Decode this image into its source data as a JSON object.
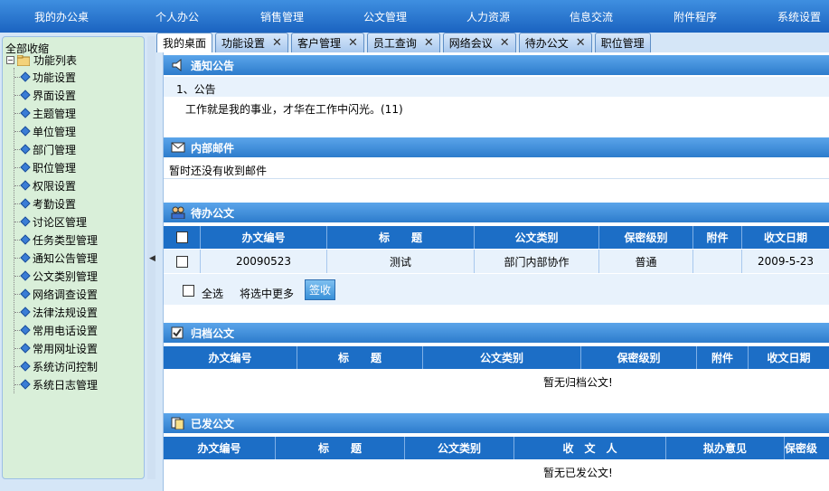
{
  "nav": {
    "home": "我的办公桌",
    "items": [
      "个人办公",
      "销售管理",
      "公文管理",
      "人力资源",
      "信息交流",
      "附件程序",
      "系统设置"
    ]
  },
  "sidebar": {
    "collapse_all": "全部收缩",
    "root_label": "功能列表",
    "items": [
      "功能设置",
      "界面设置",
      "主题管理",
      "单位管理",
      "部门管理",
      "职位管理",
      "权限设置",
      "考勤设置",
      "讨论区管理",
      "任务类型管理",
      "通知公告管理",
      "公文类别管理",
      "网络调查设置",
      "法律法规设置",
      "常用电话设置",
      "常用网址设置",
      "系统访问控制",
      "系统日志管理"
    ]
  },
  "tabs": [
    {
      "label": "我的桌面",
      "closable": false
    },
    {
      "label": "功能设置",
      "closable": true
    },
    {
      "label": "客户管理",
      "closable": true
    },
    {
      "label": "员工查询",
      "closable": true
    },
    {
      "label": "网络会议",
      "closable": true
    },
    {
      "label": "待办公文",
      "closable": true
    },
    {
      "label": "职位管理",
      "closable": false
    }
  ],
  "notice": {
    "title": "通知公告",
    "item_index": "1、公告",
    "item_text": "工作就是我的事业，才华在工作中闪光。(11)"
  },
  "mail": {
    "title": "内部邮件",
    "empty": "暂时还没有收到邮件"
  },
  "pending": {
    "title": "待办公文",
    "headers": [
      "办文编号",
      "标　　题",
      "公文类别",
      "保密级别",
      "附件",
      "收文日期"
    ],
    "row": [
      "20090523",
      "测试",
      "部门内部协作",
      "普通",
      "",
      "2009-5-23"
    ],
    "select_all": "全选",
    "more": "将选中更多",
    "sign_button": "签收"
  },
  "archived": {
    "title": "归档公文",
    "headers": [
      "办文编号",
      "标　　题",
      "公文类别",
      "保密级别",
      "附件",
      "收文日期"
    ],
    "empty": "暂无归档公文!"
  },
  "sent": {
    "title": "已发公文",
    "headers": [
      "办文编号",
      "标　　题",
      "公文类别",
      "收　文　人",
      "拟办意见",
      "保密级"
    ],
    "empty": "暂无已发公文!"
  },
  "colors": {
    "nav_bg": "#2a76cf",
    "section_bg": "#3a8ad8",
    "sidebar_bg": "#d9efd9",
    "grid_head": "#1c6ec6"
  }
}
